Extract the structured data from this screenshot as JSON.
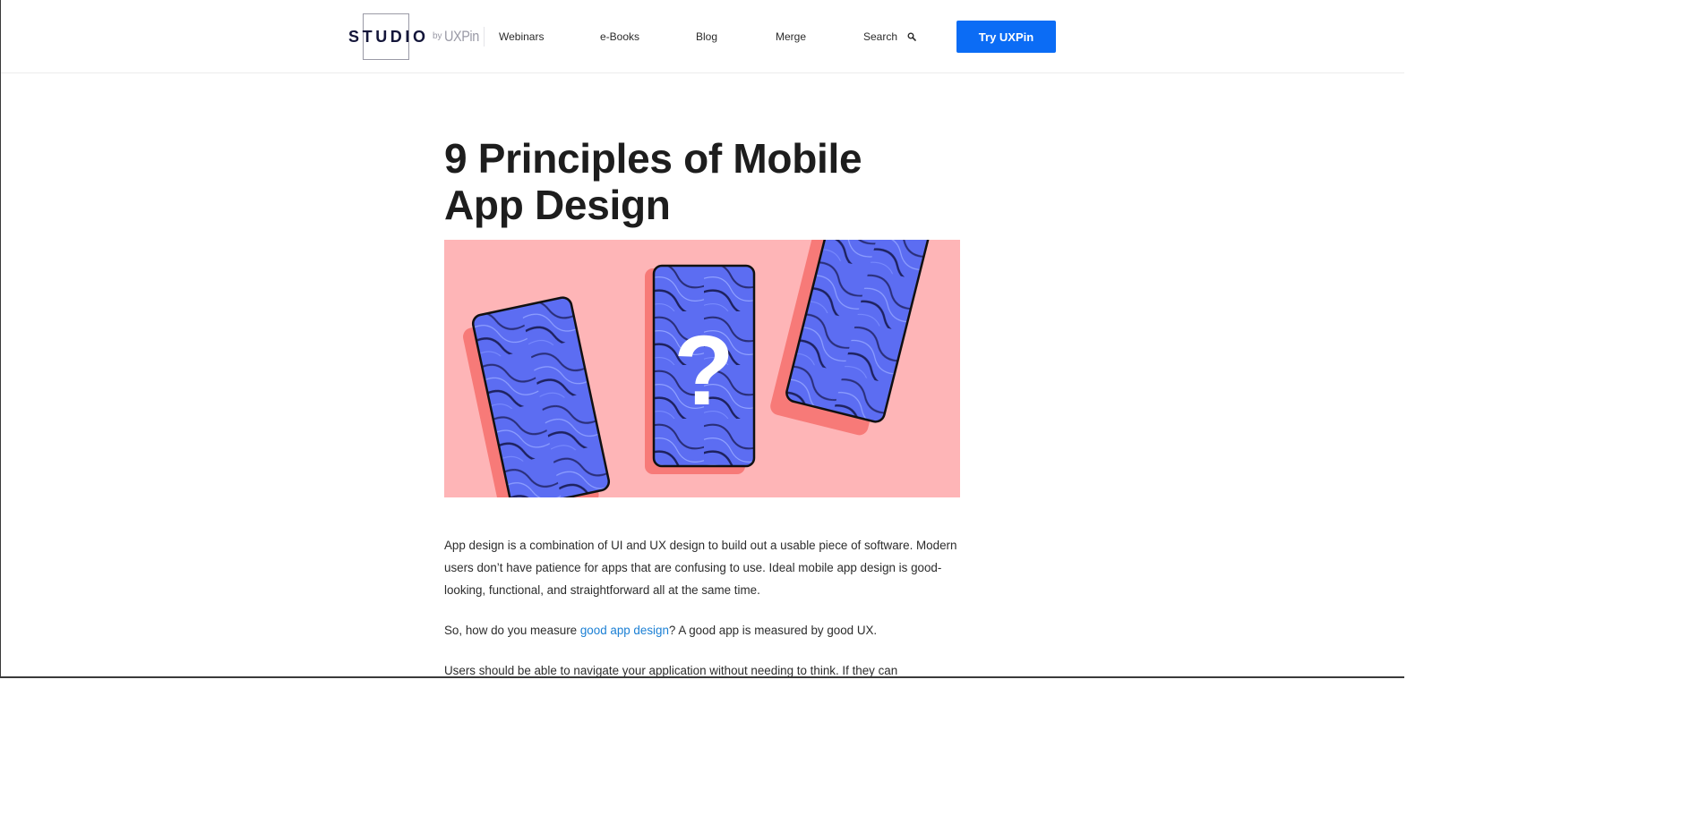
{
  "header": {
    "logo_text": "STUDIO",
    "logo_by": "by",
    "logo_brand": "UXPin",
    "nav": [
      {
        "label": "Webinars"
      },
      {
        "label": "e-Books"
      },
      {
        "label": "Blog"
      },
      {
        "label": "Merge"
      },
      {
        "label": "Search"
      }
    ],
    "cta_label": "Try UXPin"
  },
  "article": {
    "title_line1": "9 Principles of Mobile",
    "title_line2": "App Design",
    "hero_symbol": "?",
    "p1": "App design is a combination of UI and UX design to build out a usable piece of software. Modern users don’t have patience for apps that are confusing to use. Ideal mobile app design is good-looking, functional, and straightforward all at the same time.",
    "p2_before": "So, how do you measure ",
    "p2_link": "good app design",
    "p2_after": "? A good app is measured by good UX.",
    "p3": "Users should be able to navigate your application without needing to think. If they can"
  },
  "colors": {
    "accent": "#0b6cf5",
    "link": "#1a7fd4",
    "hero_bg": "#feb5b7",
    "phone_shadow": "#f77a78",
    "phone_screen": "#5c6df2"
  },
  "icons": {
    "search": "search-icon"
  }
}
